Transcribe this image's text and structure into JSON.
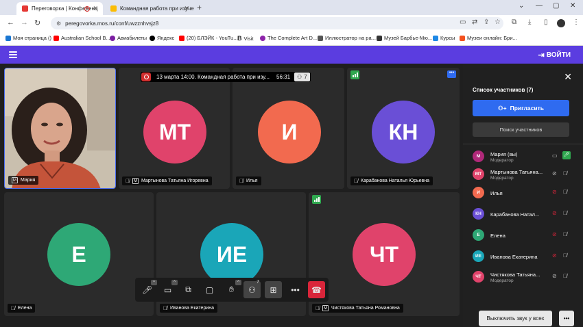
{
  "browser": {
    "tabs": [
      {
        "title": "Переговорка | Конференц",
        "favicon_color": "#e53935"
      },
      {
        "title": "Командная работа при изуче...",
        "favicon_color": "#fbbc04"
      }
    ],
    "new_tab": "+",
    "window_controls": [
      "⌄",
      "—",
      "▢",
      "✕"
    ],
    "url": "peregovorka.mos.ru/conf/uwzznhvsjz8",
    "nav": {
      "back": "←",
      "forward": "→",
      "reload": "↻"
    },
    "bookmarks": [
      {
        "label": "Моя страница ()",
        "color": "#1976d2"
      },
      {
        "label": "Australian School B...",
        "color": "#ff0000"
      },
      {
        "label": "Авиабилеты",
        "color": "#7b1fa2"
      },
      {
        "label": "Яндекс",
        "color": "#000000"
      },
      {
        "label": "(20) БЛЭЙК - YouTu...",
        "color": "#ff0000"
      },
      {
        "label": "Visit",
        "color": "#000000"
      },
      {
        "label": "The Complete Art D...",
        "color": "#8e24aa"
      },
      {
        "label": "Иллюстратор на ра...",
        "color": "#555555"
      },
      {
        "label": "Музей Барбье-Мю...",
        "color": "#333333"
      },
      {
        "label": "Курсы",
        "color": "#1e88e5"
      },
      {
        "label": "Музеи онлайн: Бри...",
        "color": "#f4511e"
      }
    ]
  },
  "app": {
    "login_label": "ВОЙТИ",
    "meeting_bar": {
      "title": "13 марта 14:00. Командная работа при изу...",
      "time": "56:31",
      "participants_count": "7"
    },
    "tiles": [
      {
        "name": "Мария",
        "initials": "",
        "color": "#000000"
      },
      {
        "name": "Мартынова Татьяна Игоревна",
        "initials": "МТ",
        "color": "#e0436b"
      },
      {
        "name": "Илья",
        "initials": "И",
        "color": "#f26a4f"
      },
      {
        "name": "Карабанова Наталья Юрьевна",
        "initials": "КН",
        "color": "#6a4fd6"
      },
      {
        "name": "Елена",
        "initials": "Е",
        "color": "#2ea876"
      },
      {
        "name": "Иванова Екатерина",
        "initials": "ИЕ",
        "color": "#1aa6b8"
      },
      {
        "name": "Чистякова Татьяна Романовна",
        "initials": "ЧТ",
        "color": "#e0436b"
      }
    ],
    "toolbar": {
      "participants_badge": "7"
    }
  },
  "panel": {
    "title": "Список участников (7)",
    "invite_label": "Пригласить",
    "search_label": "Поиск участников",
    "participants": [
      {
        "initials": "М",
        "name": "Мария (вы)",
        "role": "Модератор",
        "color": "#b0297a"
      },
      {
        "initials": "МТ",
        "name": "Мартынова Татьяна...",
        "role": "Модератор",
        "color": "#e0436b"
      },
      {
        "initials": "И",
        "name": "Илья",
        "role": "",
        "color": "#f26a4f"
      },
      {
        "initials": "КН",
        "name": "Карабанова Натал...",
        "role": "",
        "color": "#6a4fd6"
      },
      {
        "initials": "Е",
        "name": "Елена",
        "role": "",
        "color": "#2ea876"
      },
      {
        "initials": "ИЕ",
        "name": "Иванова Екатерина",
        "role": "",
        "color": "#1aa6b8"
      },
      {
        "initials": "ЧТ",
        "name": "Чистякова Татьяна...",
        "role": "Модератор",
        "color": "#e0436b"
      }
    ],
    "mute_all_label": "Выключить звук у всех",
    "more_label": "•••"
  }
}
